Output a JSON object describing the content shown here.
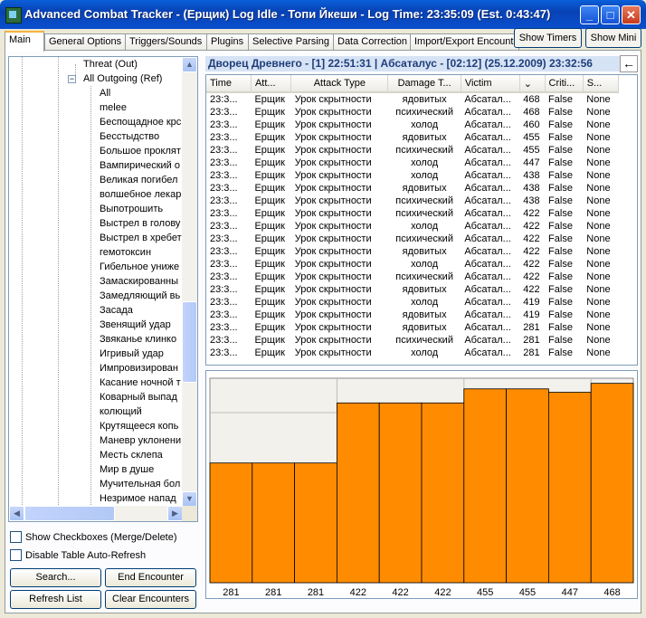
{
  "window": {
    "title": "Advanced Combat Tracker - (Ерщик) Log Idle - Топи Йкеши - Log Time: 23:35:09 (Est. 0:43:47)",
    "minimize": "_",
    "maximize": "□",
    "close": "✕"
  },
  "tabs": [
    "Main",
    "General Options",
    "Triggers/Sounds",
    "Plugins",
    "Selective Parsing",
    "Data Correction",
    "Import/Export Encount"
  ],
  "top_buttons": {
    "show_timers": "Show Timers",
    "show_mini": "Show Mini"
  },
  "tree": {
    "threat_out": "Threat (Out)",
    "all_outgoing": "All Outgoing (Ref)",
    "items": [
      "All",
      "melee",
      "Беспощадное крс",
      "Бесстыдство",
      "Большое проклят",
      "Вампирический о",
      "Великая погибел",
      "волшебное лекар",
      "Выпотрошить",
      "Выстрел в голову",
      "Выстрел в хребет",
      "гемотоксин",
      "Гибельное униже",
      "Замаскированны",
      "Замедляющий вь",
      "Засада",
      "Звенящий удар",
      "Звяканье клинко",
      "Игривый удар",
      "Импровизирован",
      "Касание ночной т",
      "Коварный выпад",
      "колющий",
      "Крутящееся копь",
      "Маневр уклонени",
      "Месть склепа",
      "Мир в душе",
      "Мучительная бол",
      "Незримое напад"
    ]
  },
  "options": {
    "show_checkboxes": "Show Checkboxes (Merge/Delete)",
    "disable_autorefresh": "Disable Table Auto-Refresh"
  },
  "buttons": {
    "search": "Search...",
    "end_encounter": "End Encounter",
    "refresh_list": "Refresh List",
    "clear_encounters": "Clear Encounters"
  },
  "encounter_header": "Дворец Древнего - [1] 22:51:31 | Абсаталус - [02:12] (25.12.2009) 23:32:56",
  "back_icon": "←",
  "table": {
    "columns": [
      "Time",
      "Att...",
      "Attack Type",
      "Damage T...",
      "Victim",
      "⌄",
      "Criti...",
      "S..."
    ],
    "rows": [
      [
        "23:3...",
        "Ерщик",
        "Урок скрытности",
        "ядовитых",
        "Абсатал...",
        "468",
        "False",
        "None"
      ],
      [
        "23:3...",
        "Ерщик",
        "Урок скрытности",
        "психический",
        "Абсатал...",
        "468",
        "False",
        "None"
      ],
      [
        "23:3...",
        "Ерщик",
        "Урок скрытности",
        "холод",
        "Абсатал...",
        "460",
        "False",
        "None"
      ],
      [
        "23:3...",
        "Ерщик",
        "Урок скрытности",
        "ядовитых",
        "Абсатал...",
        "455",
        "False",
        "None"
      ],
      [
        "23:3...",
        "Ерщик",
        "Урок скрытности",
        "психический",
        "Абсатал...",
        "455",
        "False",
        "None"
      ],
      [
        "23:3...",
        "Ерщик",
        "Урок скрытности",
        "холод",
        "Абсатал...",
        "447",
        "False",
        "None"
      ],
      [
        "23:3...",
        "Ерщик",
        "Урок скрытности",
        "холод",
        "Абсатал...",
        "438",
        "False",
        "None"
      ],
      [
        "23:3...",
        "Ерщик",
        "Урок скрытности",
        "ядовитых",
        "Абсатал...",
        "438",
        "False",
        "None"
      ],
      [
        "23:3...",
        "Ерщик",
        "Урок скрытности",
        "психический",
        "Абсатал...",
        "438",
        "False",
        "None"
      ],
      [
        "23:3...",
        "Ерщик",
        "Урок скрытности",
        "психический",
        "Абсатал...",
        "422",
        "False",
        "None"
      ],
      [
        "23:3...",
        "Ерщик",
        "Урок скрытности",
        "холод",
        "Абсатал...",
        "422",
        "False",
        "None"
      ],
      [
        "23:3...",
        "Ерщик",
        "Урок скрытности",
        "психический",
        "Абсатал...",
        "422",
        "False",
        "None"
      ],
      [
        "23:3...",
        "Ерщик",
        "Урок скрытности",
        "ядовитых",
        "Абсатал...",
        "422",
        "False",
        "None"
      ],
      [
        "23:3...",
        "Ерщик",
        "Урок скрытности",
        "холод",
        "Абсатал...",
        "422",
        "False",
        "None"
      ],
      [
        "23:3...",
        "Ерщик",
        "Урок скрытности",
        "психический",
        "Абсатал...",
        "422",
        "False",
        "None"
      ],
      [
        "23:3...",
        "Ерщик",
        "Урок скрытности",
        "ядовитых",
        "Абсатал...",
        "422",
        "False",
        "None"
      ],
      [
        "23:3...",
        "Ерщик",
        "Урок скрытности",
        "холод",
        "Абсатал...",
        "419",
        "False",
        "None"
      ],
      [
        "23:3...",
        "Ерщик",
        "Урок скрытности",
        "ядовитых",
        "Абсатал...",
        "419",
        "False",
        "None"
      ],
      [
        "23:3...",
        "Ерщик",
        "Урок скрытности",
        "ядовитых",
        "Абсатал...",
        "281",
        "False",
        "None"
      ],
      [
        "23:3...",
        "Ерщик",
        "Урок скрытности",
        "психический",
        "Абсатал...",
        "281",
        "False",
        "None"
      ],
      [
        "23:3...",
        "Ерщик",
        "Урок скрытности",
        "холод",
        "Абсатал...",
        "281",
        "False",
        "None"
      ]
    ]
  },
  "colors": {
    "bar": "#ff8c00",
    "header_bg": "#d6e3f5",
    "header_text": "#1f3d7a"
  },
  "chart_data": {
    "type": "bar",
    "categories": [
      "281",
      "281",
      "281",
      "422",
      "422",
      "422",
      "455",
      "455",
      "447",
      "468"
    ],
    "values": [
      281,
      281,
      281,
      422,
      422,
      422,
      455,
      455,
      447,
      468
    ],
    "ylim": [
      0,
      480
    ],
    "grid": true
  }
}
